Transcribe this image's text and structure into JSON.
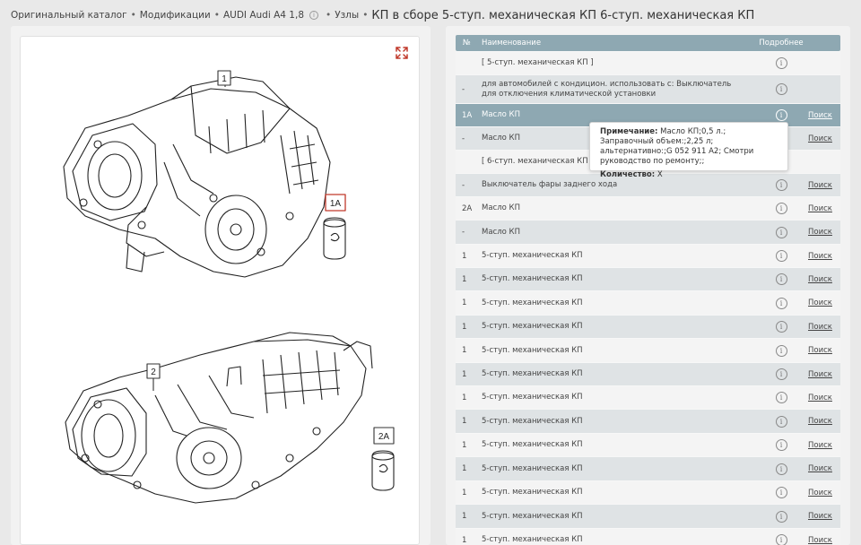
{
  "breadcrumb": {
    "items": [
      "Оригинальный каталог",
      "Модификации",
      "AUDI Audi A4 1,8",
      "Узлы"
    ],
    "current": "КП в сборе 5-ступ. механическая КП 6-ступ. механическая КП"
  },
  "diagram": {
    "callouts": [
      "1",
      "1A",
      "2",
      "2A"
    ]
  },
  "table": {
    "headers": {
      "num": "№",
      "name": "Наименование",
      "more": "Подробнее"
    },
    "link_label": "Поиск",
    "rows": [
      {
        "num": "",
        "name": "[ 5-ступ. механическая КП ]",
        "link": false
      },
      {
        "num": "-",
        "name": "для автомобилей с кондицион. использовать с: Выключатель для отключения климатической установки",
        "link": false
      },
      {
        "num": "1A",
        "name": "Масло КП",
        "link": true,
        "active": true
      },
      {
        "num": "-",
        "name": "Масло КП",
        "link": true
      },
      {
        "num": "",
        "name": "[ 6-ступ. механическая КП ]",
        "link": false
      },
      {
        "num": "-",
        "name": "Выключатель фары заднего хода",
        "link": true
      },
      {
        "num": "2A",
        "name": "Масло КП",
        "link": true
      },
      {
        "num": "-",
        "name": "Масло КП",
        "link": true
      },
      {
        "num": "1",
        "name": "5-ступ. механическая КП",
        "link": true
      },
      {
        "num": "1",
        "name": "5-ступ. механическая КП",
        "link": true
      },
      {
        "num": "1",
        "name": "5-ступ. механическая КП",
        "link": true
      },
      {
        "num": "1",
        "name": "5-ступ. механическая КП",
        "link": true
      },
      {
        "num": "1",
        "name": "5-ступ. механическая КП",
        "link": true
      },
      {
        "num": "1",
        "name": "5-ступ. механическая КП",
        "link": true
      },
      {
        "num": "1",
        "name": "5-ступ. механическая КП",
        "link": true
      },
      {
        "num": "1",
        "name": "5-ступ. механическая КП",
        "link": true
      },
      {
        "num": "1",
        "name": "5-ступ. механическая КП",
        "link": true
      },
      {
        "num": "1",
        "name": "5-ступ. механическая КП",
        "link": true
      },
      {
        "num": "1",
        "name": "5-ступ. механическая КП",
        "link": true
      },
      {
        "num": "1",
        "name": "5-ступ. механическая КП",
        "link": true
      },
      {
        "num": "1",
        "name": "5-ступ. механическая КП",
        "link": true
      }
    ]
  },
  "tooltip": {
    "note_label": "Примечание:",
    "note_text": "Масло КП;0,5 л.; Заправочный объем:;2,25 л; альтернативно:;G 052 911 A2; Смотри руководство по ремонту;;",
    "qty_label": "Количество:",
    "qty_value": "X"
  },
  "colors": {
    "header_bg": "#8ea8b2",
    "row_alt": "#dfe3e5",
    "callout_red": "#c0392b"
  },
  "icons": {
    "expand": "expand-arrows-icon",
    "info": "info-circle-icon"
  }
}
